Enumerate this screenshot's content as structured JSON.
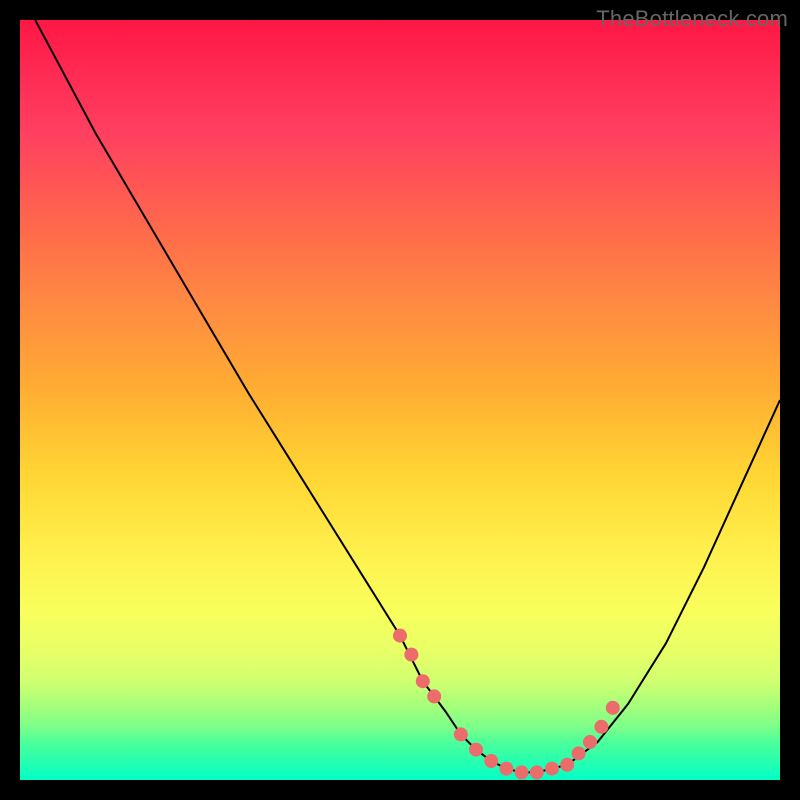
{
  "watermark": "TheBottleneck.com",
  "chart_data": {
    "type": "line",
    "title": "",
    "xlabel": "",
    "ylabel": "",
    "xlim": [
      0,
      100
    ],
    "ylim": [
      0,
      100
    ],
    "grid": false,
    "legend": false,
    "description": "Bottleneck curve with vertical rainbow gradient background (red=high bottleneck at top, green=low bottleneck at bottom). Black V-shaped curve with salmon dots near the minimum.",
    "series": [
      {
        "name": "bottleneck-curve",
        "x": [
          2,
          10,
          20,
          30,
          35,
          40,
          45,
          50,
          53,
          56,
          58,
          60,
          62,
          64,
          66,
          68,
          72,
          76,
          80,
          85,
          90,
          95,
          100
        ],
        "y": [
          100,
          85,
          68,
          51,
          43,
          35,
          27,
          19,
          13,
          9,
          6,
          4,
          2.5,
          1.5,
          1,
          1,
          2,
          5,
          10,
          18,
          28,
          39,
          50
        ]
      }
    ],
    "markers": {
      "name": "highlight-dots",
      "color": "#ec6b6b",
      "x": [
        50,
        51.5,
        53,
        54.5,
        58,
        60,
        62,
        64,
        66,
        68,
        70,
        72,
        73.5,
        75,
        76.5,
        78
      ],
      "y": [
        19,
        16.5,
        13,
        11,
        6,
        4,
        2.5,
        1.5,
        1,
        1,
        1.5,
        2,
        3.5,
        5,
        7,
        9.5
      ]
    }
  }
}
